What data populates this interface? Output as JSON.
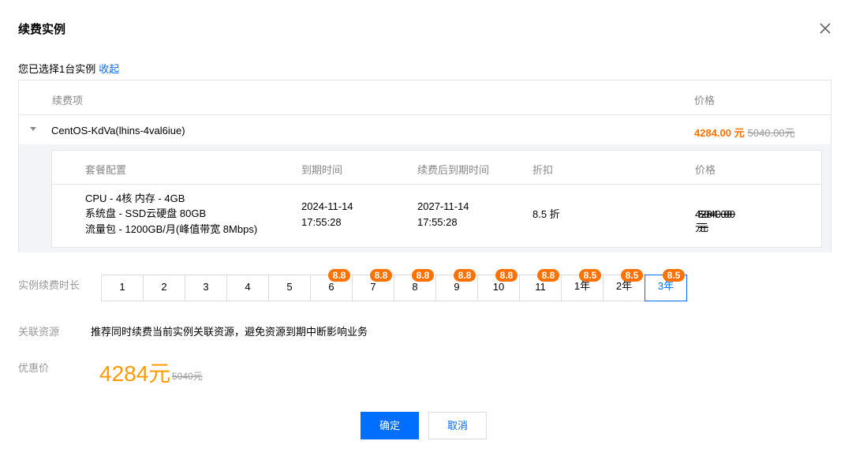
{
  "dialog": {
    "title": "续费实例",
    "selected_text": "您已选择1台实例",
    "collapse_link": "收起"
  },
  "outer_table": {
    "headers": [
      "续费项",
      "价格"
    ],
    "instance": {
      "name": "CentOS-KdVa(lhins-4val6iue)",
      "price_now": "4284.00 元",
      "price_old": "5040.00元"
    }
  },
  "inner_table": {
    "headers": [
      "套餐配置",
      "到期时间",
      "续费后到期时间",
      "折扣",
      "价格"
    ],
    "config_lines": [
      "CPU - 4核 内存 - 4GB",
      "系统盘 - SSD云硬盘 80GB",
      "流量包 - 1200GB/月(峰值带宽 8Mbps)"
    ],
    "expire_date": "2024-11-14",
    "expire_time": "17:55:28",
    "new_expire_date": "2027-11-14",
    "new_expire_time": "17:55:28",
    "discount": "8.5 折",
    "price_now": "4284.00 元",
    "price_old": "5040.00元"
  },
  "duration": {
    "label": "实例续费时长",
    "options": [
      {
        "label": "1",
        "badge": ""
      },
      {
        "label": "2",
        "badge": ""
      },
      {
        "label": "3",
        "badge": ""
      },
      {
        "label": "4",
        "badge": ""
      },
      {
        "label": "5",
        "badge": ""
      },
      {
        "label": "6",
        "badge": "8.8"
      },
      {
        "label": "7",
        "badge": "8.8"
      },
      {
        "label": "8",
        "badge": "8.8"
      },
      {
        "label": "9",
        "badge": "8.8"
      },
      {
        "label": "10",
        "badge": "8.8"
      },
      {
        "label": "11",
        "badge": "8.8"
      },
      {
        "label": "1年",
        "badge": "8.5"
      },
      {
        "label": "2年",
        "badge": "8.5"
      },
      {
        "label": "3年",
        "badge": "8.5"
      }
    ],
    "selected": "3年"
  },
  "related": {
    "label": "关联资源",
    "text": "推荐同时续费当前实例关联资源，避免资源到期中断影响业务"
  },
  "discount_price": {
    "label": "优惠价",
    "value": "4284元",
    "old": "5040元"
  },
  "buttons": {
    "confirm": "确定",
    "cancel": "取消"
  },
  "colors": {
    "primary": "#006eff",
    "orange": "#ff7200",
    "price_orange": "#ff9b00"
  }
}
